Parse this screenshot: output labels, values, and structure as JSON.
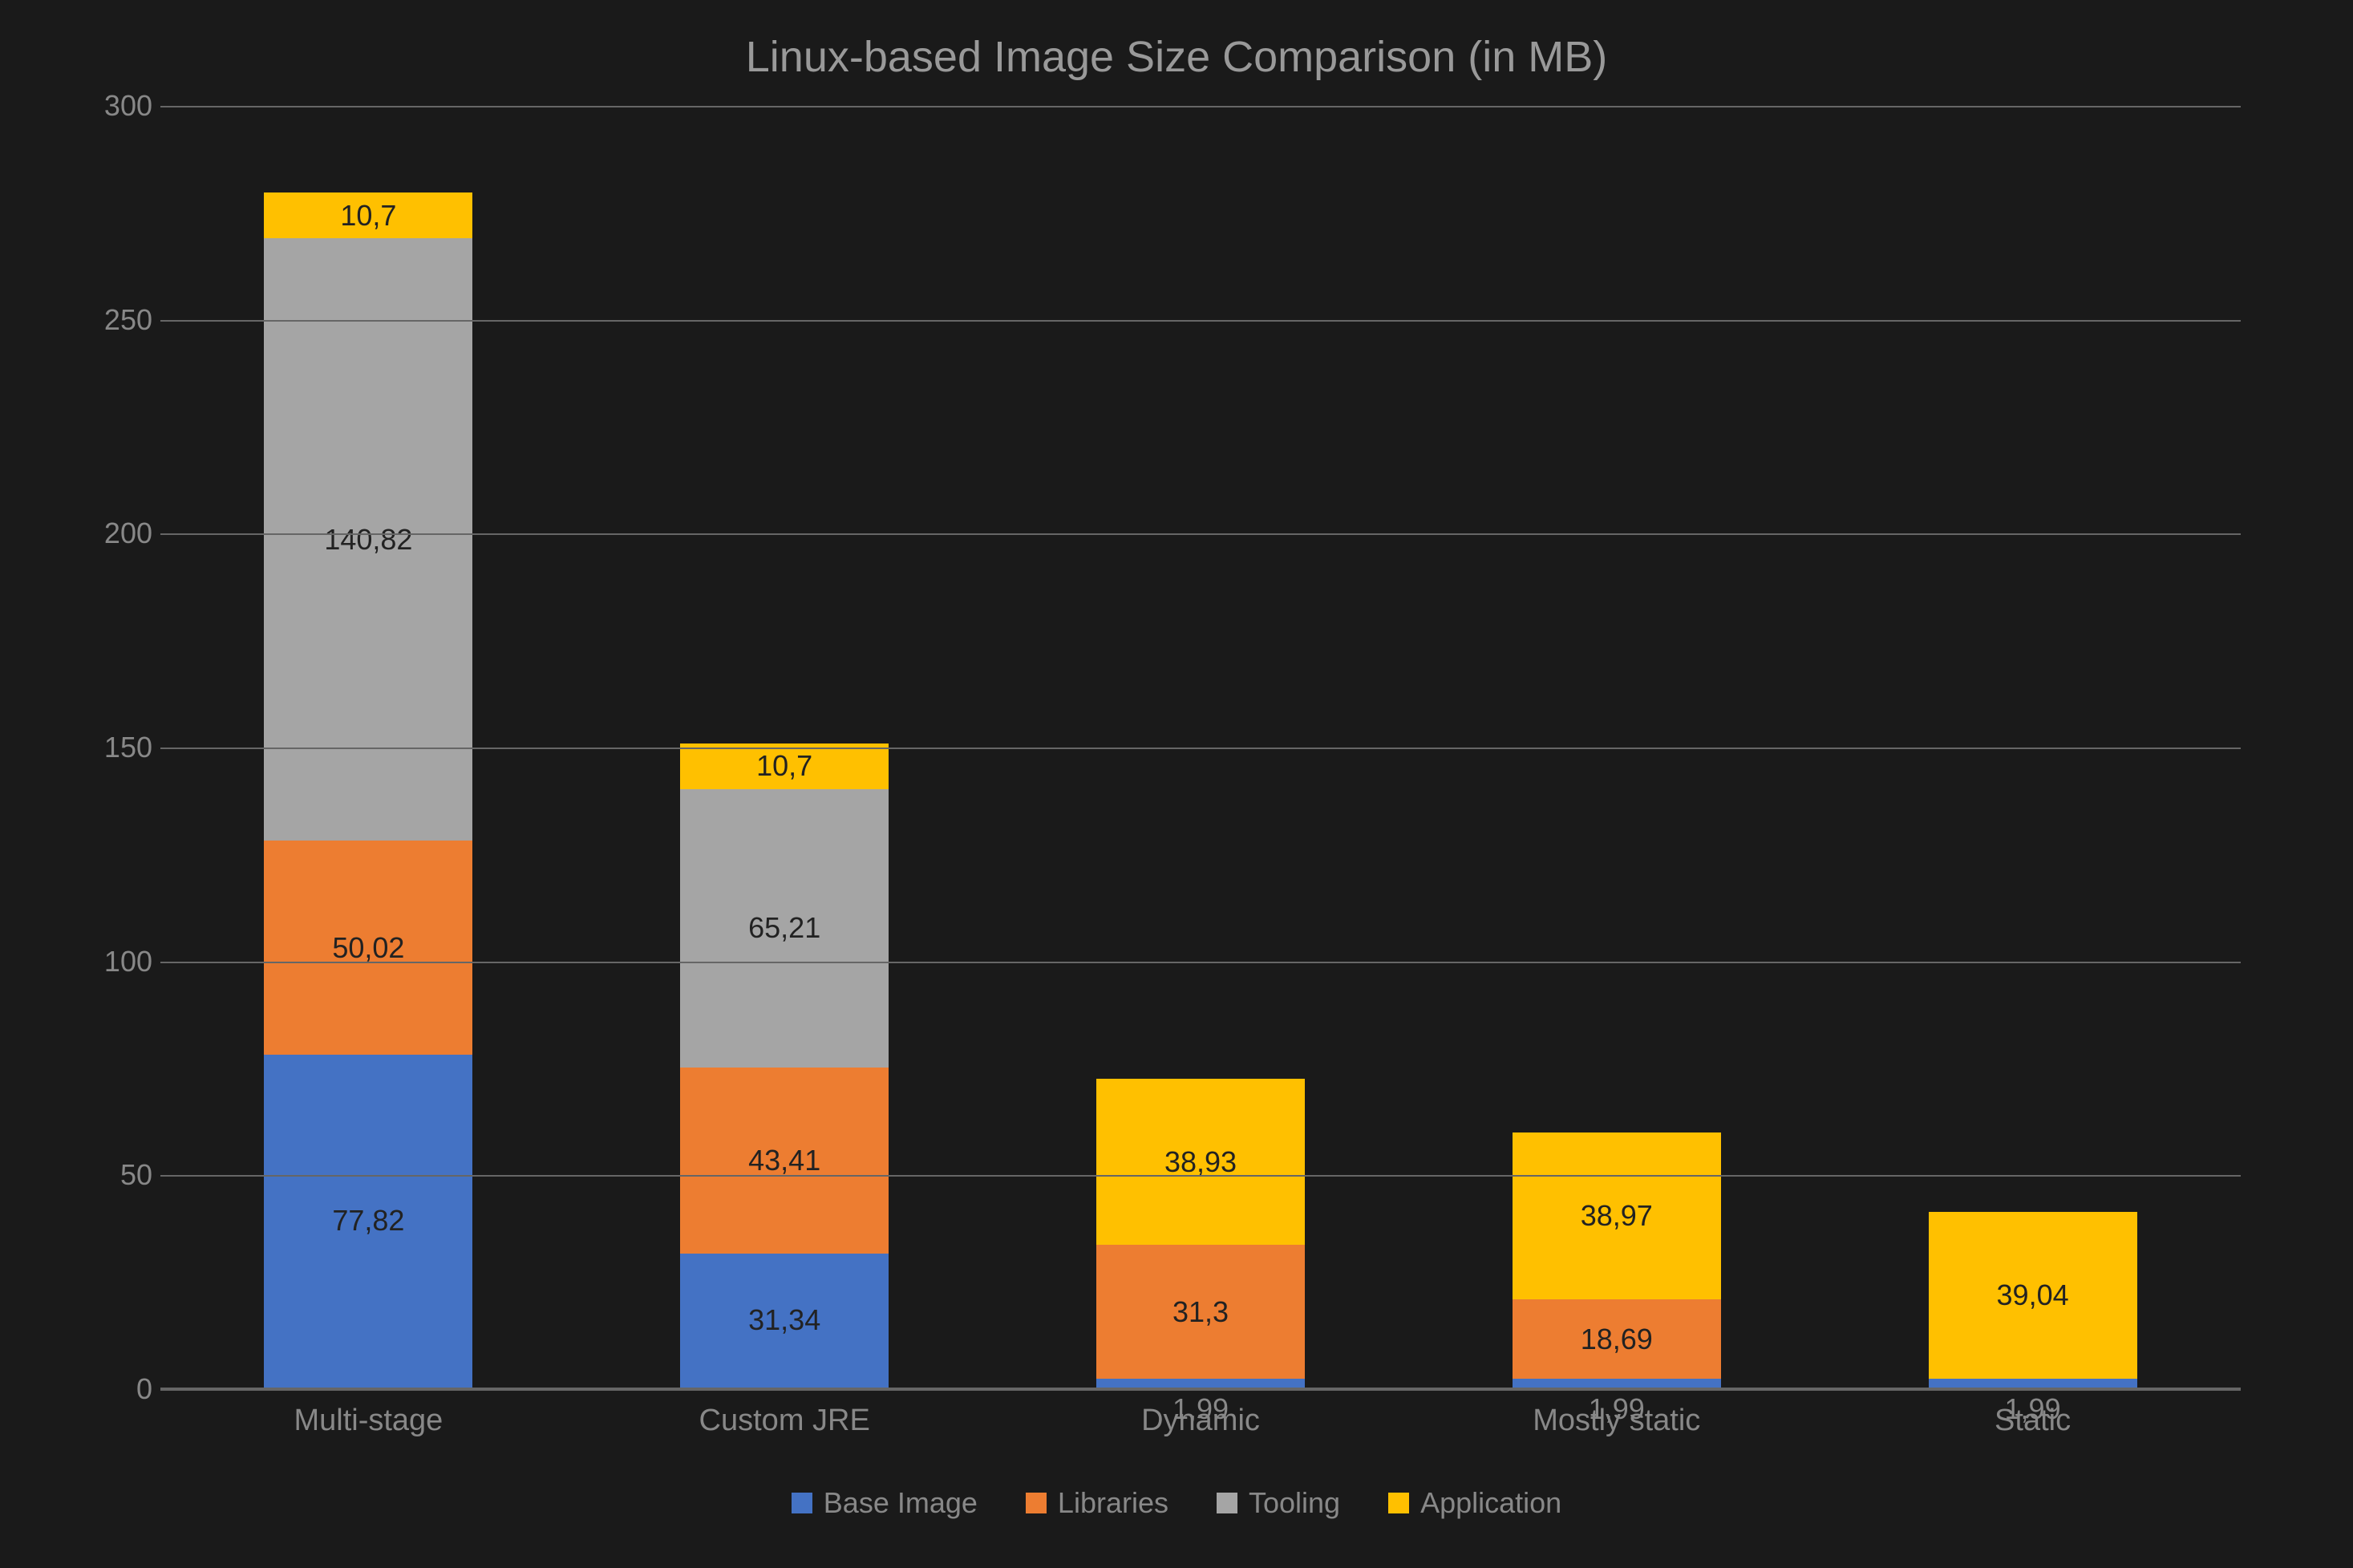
{
  "chart_data": {
    "type": "bar",
    "stacked": true,
    "title": "Linux-based Image Size Comparison (in MB)",
    "xlabel": "",
    "ylabel": "",
    "y_ticks": [
      0,
      50,
      100,
      150,
      200,
      250,
      300
    ],
    "ylim": [
      0,
      300
    ],
    "categories": [
      "Multi-stage",
      "Custom JRE",
      "Dynamic",
      "Mostly static",
      "Static"
    ],
    "series": [
      {
        "name": "Base Image",
        "color": "#4472C4",
        "values": [
          77.82,
          31.34,
          1.99,
          1.99,
          1.99
        ]
      },
      {
        "name": "Libraries",
        "color": "#ED7D31",
        "values": [
          50.02,
          43.41,
          31.3,
          18.69,
          null
        ]
      },
      {
        "name": "Tooling",
        "color": "#A5A5A5",
        "values": [
          140.82,
          65.21,
          null,
          null,
          null
        ]
      },
      {
        "name": "Application",
        "color": "#FFC000",
        "values": [
          10.7,
          10.7,
          38.93,
          38.97,
          39.04
        ]
      }
    ],
    "value_labels": {
      "Multi-stage": {
        "Base Image": "77,82",
        "Libraries": "50,02",
        "Tooling": "140,82",
        "Application": "10,7"
      },
      "Custom JRE": {
        "Base Image": "31,34",
        "Libraries": "43,41",
        "Tooling": "65,21",
        "Application": "10,7"
      },
      "Dynamic": {
        "Base Image": "1,99",
        "Libraries": "31,3",
        "Application": "38,93"
      },
      "Mostly static": {
        "Base Image": "1,99",
        "Libraries": "18,69",
        "Application": "38,97"
      },
      "Static": {
        "Base Image": "1,99",
        "Application": "39,04"
      }
    },
    "legend_position": "bottom"
  }
}
